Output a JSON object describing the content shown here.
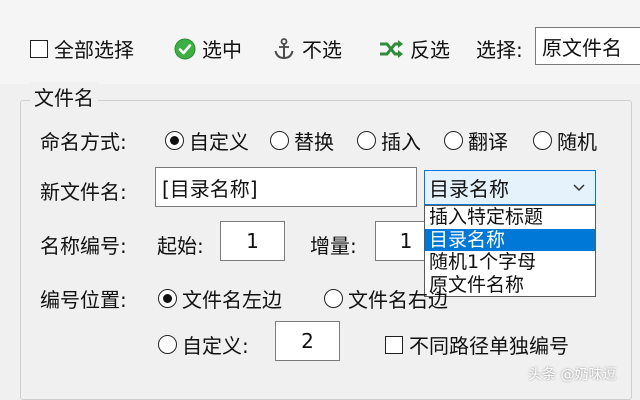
{
  "toolbar": {
    "select_all": "全部选择",
    "select": "选中",
    "deselect": "不选",
    "invert": "反选",
    "select_label": "选择:",
    "select_value": "原文件名"
  },
  "group": {
    "title": "文件名",
    "naming_mode": {
      "label": "命名方式:",
      "options": [
        "自定义",
        "替换",
        "插入",
        "翻译",
        "随机"
      ],
      "selected": "自定义"
    },
    "new_name": {
      "label": "新文件名:",
      "value": "[目录名称]",
      "combo_value": "目录名称",
      "dropdown_items": [
        "插入特定标题",
        "目录名称",
        "随机1个字母",
        "原文件名称"
      ],
      "dropdown_selected": "目录名称"
    },
    "numbering": {
      "label": "名称编号:",
      "start_label": "起始:",
      "start_value": "1",
      "step_label": "增量:",
      "step_value": "1"
    },
    "position": {
      "label": "编号位置:",
      "left": "文件名左边",
      "right": "文件名右边",
      "custom": "自定义:",
      "custom_value": "2",
      "separate": "不同路径单独编号"
    }
  },
  "watermark": "头条 @奶味逗",
  "colors": {
    "accent": "#0078d7",
    "check_green": "#3cb043"
  }
}
